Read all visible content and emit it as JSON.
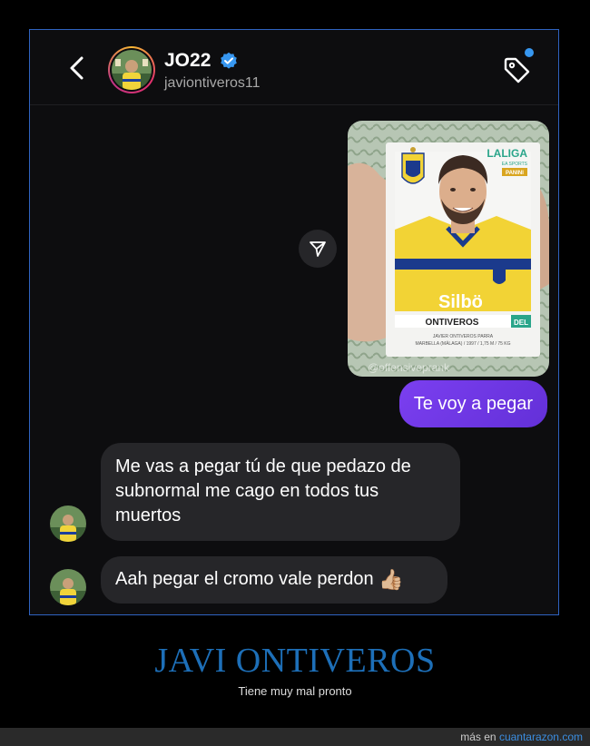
{
  "header": {
    "username": "JO22",
    "handle": "javiontiveros11",
    "verified": true,
    "back_icon": "chevron-left-icon",
    "tag_icon": "tag-icon"
  },
  "photo": {
    "card_brand": "LALIGA",
    "card_brand_sub": "EA SPORTS",
    "card_sponsor": "PANINI",
    "card_name": "ONTIVEROS",
    "card_position": "DEL",
    "card_fullname": "JAVIER ONTIVEROS PARRA",
    "card_details": "MARBELLA (MÁLAGA) / 1997 / 1,75 M / 75 KG",
    "shirt_text": "Silbö",
    "watermark": "@offensiveprank"
  },
  "messages": {
    "outgoing": "Te voy a pegar",
    "incoming_1": "Me vas a pegar tú de que pedazo de subnormal me cago en todos tus muertos",
    "incoming_2": "Aah pegar el cromo vale perdon",
    "emoji": "👍🏼"
  },
  "caption": {
    "title": "JAVI ONTIVEROS",
    "subtitle": "Tiene muy mal pronto"
  },
  "footer": {
    "prefix": "más en",
    "link": "cuantarazon.com"
  },
  "colors": {
    "frame_border": "#2f63c0",
    "outgoing_bubble": "#6f35e6",
    "incoming_bubble": "#262629",
    "title": "#1d6fb8",
    "link": "#3b8de0",
    "notification": "#3797f0"
  }
}
